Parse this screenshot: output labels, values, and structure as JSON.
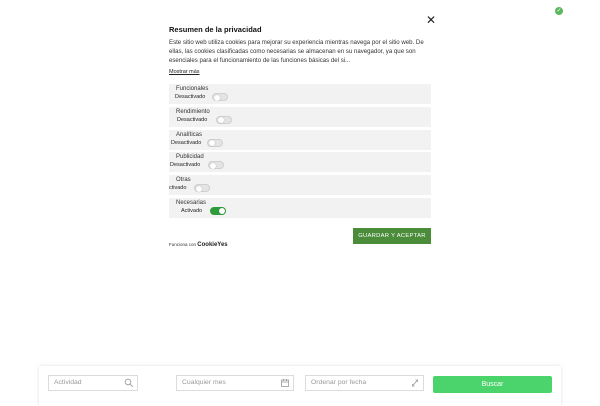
{
  "badge": {
    "icon": "check-icon"
  },
  "modal": {
    "close_glyph": "✕",
    "title": "Resumen de la privacidad",
    "description": "Este sitio web utiliza cookies para mejorar su experiencia mientras navega por el sitio web. De ellas, las cookies clasificadas como necesarias se almacenan en su navegador, ya que son esenciales para el funcionamiento de las funciones básicas del si...",
    "show_more": "Mostrar más",
    "categories": [
      {
        "name": "Funcionales",
        "status": "Desactivado",
        "enabled": false
      },
      {
        "name": "Rendimiento",
        "status": "Desactivado",
        "enabled": false
      },
      {
        "name": "Analíticas",
        "status": "Desactivado",
        "enabled": false
      },
      {
        "name": "Publicidad",
        "status": "Desactivado",
        "enabled": false
      },
      {
        "name": "Otras",
        "status": "ctivado",
        "enabled": false
      },
      {
        "name": "Necesarias",
        "status": "Activado",
        "enabled": true
      }
    ],
    "save_button": "GUARDAR Y ACEPTAR",
    "powered_by": "Funciona con",
    "powered_brand": "CookieYes"
  },
  "search": {
    "activity_placeholder": "Actividad",
    "month_placeholder": "Cualquier mes",
    "order_placeholder": "Ordenar por fecha",
    "search_button": "Buscar"
  },
  "colors": {
    "accent_green": "#4a8c3a",
    "toggle_on": "#2e9c3a",
    "search_button": "#4cd46c"
  }
}
